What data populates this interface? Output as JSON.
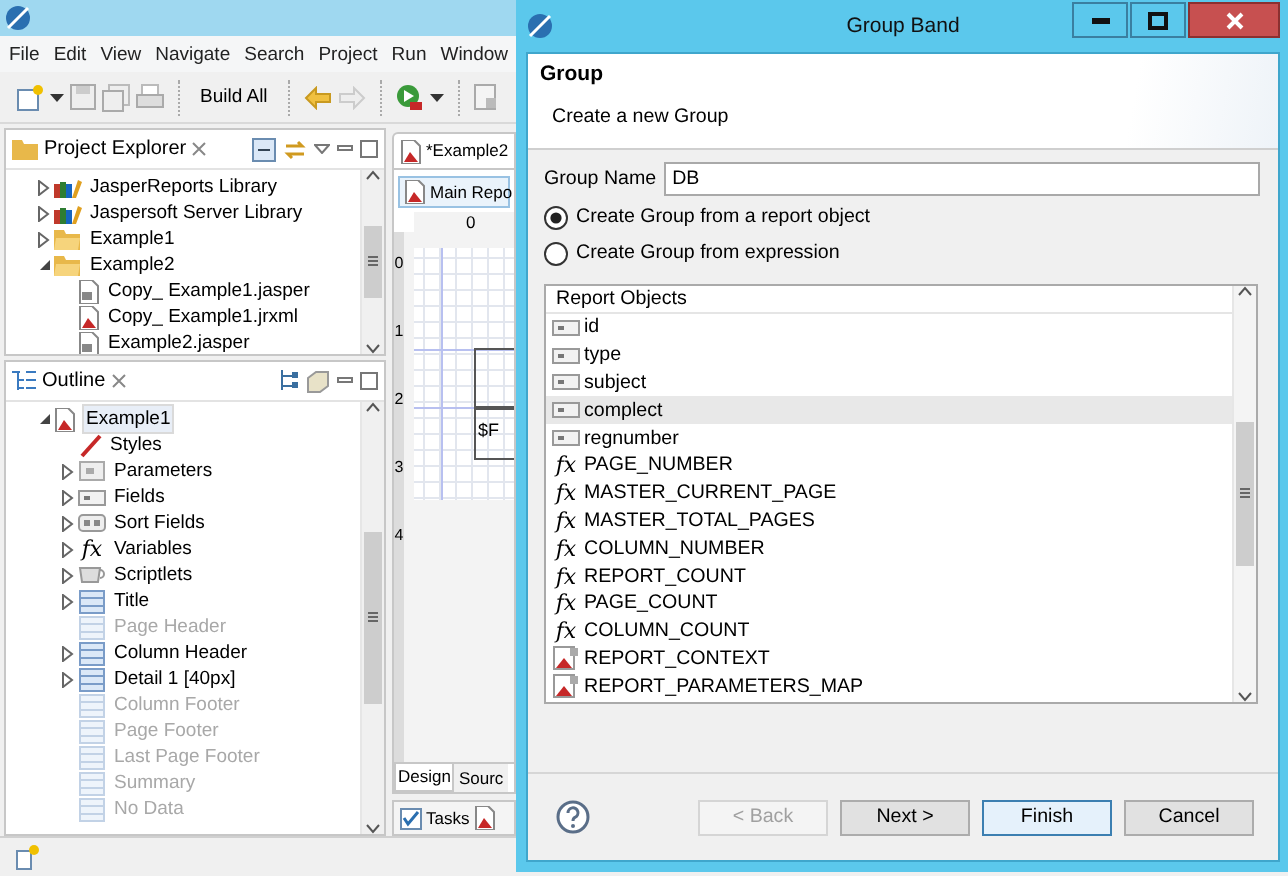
{
  "ide": {
    "menu": [
      "File",
      "Edit",
      "View",
      "Navigate",
      "Search",
      "Project",
      "Run",
      "Window"
    ],
    "toolbar": {
      "build_all": "Build All"
    },
    "project_explorer": {
      "title": "Project Explorer",
      "items": [
        {
          "label": "JasperReports Library",
          "kind": "library",
          "expanded": false
        },
        {
          "label": "Jaspersoft Server Library",
          "kind": "library",
          "expanded": false
        },
        {
          "label": "Example1",
          "kind": "folder",
          "expanded": false
        },
        {
          "label": "Example2",
          "kind": "folder",
          "expanded": true,
          "children": [
            {
              "label": "Copy_ Example1.jasper",
              "kind": "jasper"
            },
            {
              "label": "Copy_ Example1.jrxml",
              "kind": "report"
            },
            {
              "label": "Example2.jasper",
              "kind": "jasper"
            }
          ]
        }
      ]
    },
    "outline": {
      "title": "Outline",
      "items": [
        {
          "label": "Example1",
          "kind": "report",
          "expanded": true,
          "selected": true,
          "children": [
            {
              "label": "Styles",
              "kind": "styles",
              "disabled": false
            },
            {
              "label": "Parameters",
              "kind": "parameters",
              "expanded": false,
              "disabled": false
            },
            {
              "label": "Fields",
              "kind": "fields",
              "expanded": false,
              "disabled": false
            },
            {
              "label": "Sort Fields",
              "kind": "sort",
              "expanded": false,
              "disabled": false
            },
            {
              "label": "Variables",
              "kind": "glyph",
              "glyph": "fx",
              "expanded": false,
              "disabled": false
            },
            {
              "label": "Scriptlets",
              "kind": "scriptlets",
              "expanded": false,
              "disabled": false
            },
            {
              "label": "Title",
              "kind": "band",
              "expanded": false,
              "disabled": false
            },
            {
              "label": "Page Header",
              "kind": "band",
              "disabled": true
            },
            {
              "label": "Column Header",
              "kind": "band",
              "expanded": false,
              "disabled": false
            },
            {
              "label": "Detail 1 [40px]",
              "kind": "band",
              "expanded": false,
              "disabled": false
            },
            {
              "label": "Column Footer",
              "kind": "band",
              "disabled": true
            },
            {
              "label": "Page Footer",
              "kind": "band",
              "disabled": true
            },
            {
              "label": "Last Page Footer",
              "kind": "band",
              "disabled": true
            },
            {
              "label": "Summary",
              "kind": "band",
              "disabled": true
            },
            {
              "label": "No Data",
              "kind": "band",
              "disabled": true
            }
          ]
        }
      ]
    },
    "editor": {
      "tab": "*Example2",
      "subtab": "Main Repo",
      "top_ruler": [
        "0"
      ],
      "side_ruler": [
        "0",
        "1",
        "2",
        "3",
        "4"
      ],
      "canvas_text": "$F",
      "bottom_tabs": [
        {
          "label": "Design",
          "selected": true
        },
        {
          "label": "Sourc",
          "selected": false
        }
      ],
      "view_tabs": [
        {
          "label": "Tasks"
        }
      ]
    }
  },
  "dialog": {
    "title": "Group Band",
    "header": {
      "title": "Group",
      "subtitle": "Create a new Group"
    },
    "group_name": {
      "label": "Group Name",
      "value": "DB"
    },
    "options": [
      {
        "label": "Create Group from a report object",
        "selected": true
      },
      {
        "label": "Create Group from expression",
        "selected": false
      }
    ],
    "list": {
      "header": "Report Objects",
      "items": [
        {
          "label": "id",
          "kind": "field",
          "selected": false
        },
        {
          "label": "type",
          "kind": "field",
          "selected": false
        },
        {
          "label": "subject",
          "kind": "field",
          "selected": false
        },
        {
          "label": "complect",
          "kind": "field",
          "selected": true
        },
        {
          "label": "regnumber",
          "kind": "field",
          "selected": false
        },
        {
          "label": "PAGE_NUMBER",
          "kind": "glyph",
          "glyph": "fx",
          "selected": false
        },
        {
          "label": "MASTER_CURRENT_PAGE",
          "kind": "glyph",
          "glyph": "fx",
          "selected": false
        },
        {
          "label": "MASTER_TOTAL_PAGES",
          "kind": "glyph",
          "glyph": "fx",
          "selected": false
        },
        {
          "label": "COLUMN_NUMBER",
          "kind": "glyph",
          "glyph": "fx",
          "selected": false
        },
        {
          "label": "REPORT_COUNT",
          "kind": "glyph",
          "glyph": "fx",
          "selected": false
        },
        {
          "label": "PAGE_COUNT",
          "kind": "glyph",
          "glyph": "fx",
          "selected": false
        },
        {
          "label": "COLUMN_COUNT",
          "kind": "glyph",
          "glyph": "fx",
          "selected": false
        },
        {
          "label": "REPORT_CONTEXT",
          "kind": "parameter",
          "selected": false
        },
        {
          "label": "REPORT_PARAMETERS_MAP",
          "kind": "parameter",
          "selected": false
        }
      ]
    },
    "buttons": [
      {
        "label": "< Back",
        "disabled": true,
        "default": false
      },
      {
        "label": "Next >",
        "disabled": false,
        "default": false
      },
      {
        "label": "Finish",
        "disabled": false,
        "default": true
      },
      {
        "label": "Cancel",
        "disabled": false,
        "default": false
      }
    ]
  }
}
